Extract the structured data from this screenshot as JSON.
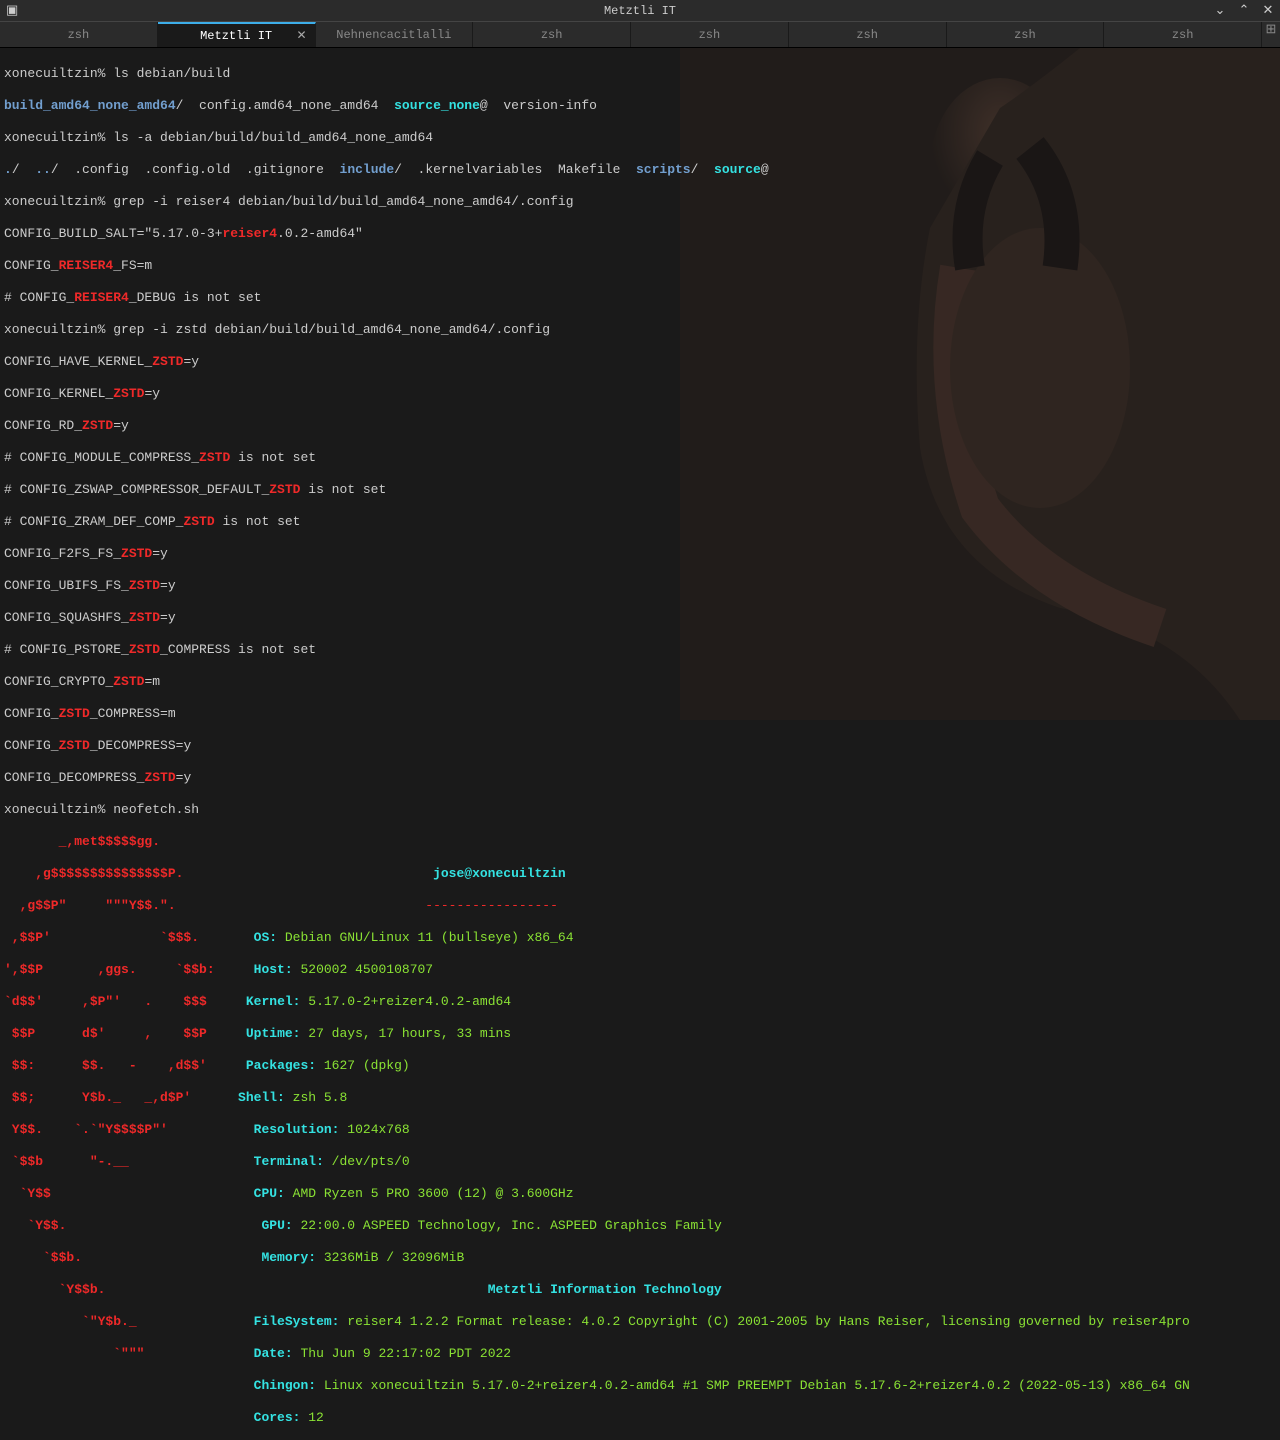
{
  "title": "Metztli IT",
  "tabs": [
    "zsh",
    "Metztli IT",
    "Nehnencacitlalli",
    "zsh",
    "zsh",
    "zsh",
    "zsh",
    "zsh"
  ],
  "active_tab": 1,
  "prompt": "xonecuiltzin%",
  "cmd1": "ls debian/build",
  "ls1_a": "build_amd64_none_amd64",
  "ls1_b": "config.amd64_none_amd64",
  "ls1_c": "source_none",
  "ls1_d": "@",
  "ls1_e": "version-info",
  "cmd2": "ls -a debian/build/build_amd64_none_amd64",
  "ls2_a": ".",
  "ls2_b": "..",
  "ls2_c": ".config",
  "ls2_d": ".config.old",
  "ls2_e": ".gitignore",
  "ls2_f": "include",
  "ls2_g": ".kernelvariables",
  "ls2_h": "Makefile",
  "ls2_i": "scripts",
  "ls2_j": "source",
  "ls2_k": "@",
  "cmd3": "grep -i reiser4 debian/build/build_amd64_none_amd64/.config",
  "g1a": "CONFIG_BUILD_SALT=\"5.17.0-3+",
  "g1b": "reiser4",
  "g1c": ".0.2-amd64\"",
  "g2a": "CONFIG_",
  "g2b": "REISER4",
  "g2c": "_FS=m",
  "g3a": "# CONFIG_",
  "g3b": "REISER4",
  "g3c": "_DEBUG is not set",
  "cmd4": "grep -i zstd debian/build/build_amd64_none_amd64/.config",
  "z1a": "CONFIG_HAVE_KERNEL_",
  "z1b": "ZSTD",
  "z1c": "=y",
  "z2a": "CONFIG_KERNEL_",
  "z2b": "ZSTD",
  "z2c": "=y",
  "z3a": "CONFIG_RD_",
  "z3b": "ZSTD",
  "z3c": "=y",
  "z4a": "# CONFIG_MODULE_COMPRESS_",
  "z4b": "ZSTD",
  "z4c": " is not set",
  "z5a": "# CONFIG_ZSWAP_COMPRESSOR_DEFAULT_",
  "z5b": "ZSTD",
  "z5c": " is not set",
  "z6a": "# CONFIG_ZRAM_DEF_COMP_",
  "z6b": "ZSTD",
  "z6c": " is not set",
  "z7a": "CONFIG_F2FS_FS_",
  "z7b": "ZSTD",
  "z7c": "=y",
  "z8a": "CONFIG_UBIFS_FS_",
  "z8b": "ZSTD",
  "z8c": "=y",
  "z9a": "CONFIG_SQUASHFS_",
  "z9b": "ZSTD",
  "z9c": "=y",
  "z10a": "# CONFIG_PSTORE_",
  "z10b": "ZSTD",
  "z10c": "_COMPRESS is not set",
  "z11a": "CONFIG_CRYPTO_",
  "z11b": "ZSTD",
  "z11c": "=m",
  "z12a": "CONFIG_",
  "z12b": "ZSTD",
  "z12c": "_COMPRESS=m",
  "z13a": "CONFIG_",
  "z13b": "ZSTD",
  "z13c": "_DECOMPRESS=y",
  "z14a": "CONFIG_DECOMPRESS_",
  "z14b": "ZSTD",
  "z14c": "=y",
  "cmd5": "neofetch.sh",
  "logo1": "       _,met$$$$$gg.",
  "logo2": "    ,g$$$$$$$$$$$$$$$P.",
  "logo3": "  ,g$$P\"     \"\"\"Y$$.\".",
  "logo4": " ,$$P'              `$$$.",
  "logo5": "',$$P       ,ggs.     `$$b:",
  "logo6": "`d$$'     ,$P\"'   .    $$$",
  "logo7": " $$P      d$'     ,    $$P",
  "logo8": " $$:      $$.   -    ,d$$'",
  "logo9": " $$;      Y$b._   _,d$P'",
  "logo10": " Y$$.    `.`\"Y$$$$P\"'",
  "logo11": " `$$b      \"-.__",
  "logo12": "  `Y$$",
  "logo13": "   `Y$$.",
  "logo14": "     `$$b.",
  "logo15": "       `Y$$b.",
  "logo16": "          `\"Y$b._",
  "logo17": "              `\"\"\"",
  "nf_user": "jose@xonecuiltzin",
  "nf_dash": "-----------------",
  "nf_os_k": "OS:",
  "nf_os_v": " Debian GNU/Linux 11 (bullseye) x86_64",
  "nf_host_k": "Host:",
  "nf_host_v": " 520002 4500108707",
  "nf_kernel_k": "Kernel:",
  "nf_kernel_v": " 5.17.0-2+reizer4.0.2-amd64",
  "nf_uptime_k": "Uptime:",
  "nf_uptime_v": " 27 days, 17 hours, 33 mins",
  "nf_pkg_k": "Packages:",
  "nf_pkg_v": " 1627 (dpkg)",
  "nf_shell_k": "Shell:",
  "nf_shell_v": " zsh 5.8",
  "nf_res_k": "Resolution:",
  "nf_res_v": " 1024x768",
  "nf_term_k": "Terminal:",
  "nf_term_v": " /dev/pts/0",
  "nf_cpu_k": "CPU:",
  "nf_cpu_v": " AMD Ryzen 5 PRO 3600 (12) @ 3.600GHz",
  "nf_gpu_k": "GPU:",
  "nf_gpu_v": " 22:00.0 ASPEED Technology, Inc. ASPEED Graphics Family",
  "nf_mem_k": "Memory:",
  "nf_mem_v": " 3236MiB / 32096MiB",
  "nf_mit": "Metztli Information Technology",
  "nf_fs_k": "FileSystem:",
  "nf_fs_v": " reiser4 1.2.2 Format release: 4.0.2 Copyright (C) 2001-2005 by Hans Reiser, licensing governed by reiser4pro",
  "nf_date_k": "Date:",
  "nf_date_v": " Thu Jun 9 22:17:02 PDT 2022",
  "nf_chingon_k": "Chingon:",
  "nf_chingon_v": " Linux xonecuiltzin 5.17.0-2+reizer4.0.2-amd64 #1 SMP PREEMPT Debian 5.17.6-2+reizer4.0.2 (2022-05-13) x86_64 GN",
  "nf_cores_k": "Cores:",
  "nf_cores_v": " 12",
  "pad": "                                "
}
